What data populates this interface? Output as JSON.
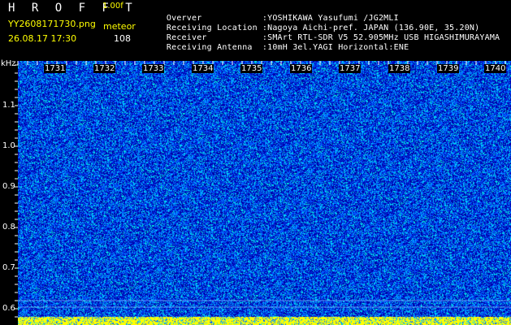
{
  "header": {
    "title": "H R O F F T",
    "version": "1.00f",
    "filename": "YY2608171730.png",
    "mode": "meteor",
    "datetime": "26.08.17 17:30",
    "count": "108"
  },
  "station": [
    {
      "label": "Overver",
      "value": ":YOSHIKAWA Yasufumi /JG2MLI"
    },
    {
      "label": "Receiving Location",
      "value": ":Nagoya Aichi-pref. JAPAN (136.90E, 35.20N)"
    },
    {
      "label": "Receiver",
      "value": ":SMArt RTL-SDR V5 52.905MHz USB HIGASHIMURAYAMA"
    },
    {
      "label": "Receiving Antenna",
      "value": ":10mH 3el.YAGI Horizontal:ENE"
    }
  ],
  "axis": {
    "unit": "kHz",
    "freq_ticks": [
      "1.1",
      "1.0",
      "0.9",
      "0.8",
      "0.7",
      "0.6"
    ],
    "time_labels": [
      "1731",
      "1732",
      "1733",
      "1734",
      "1735",
      "1736",
      "1737",
      "1738",
      "1739",
      "1740"
    ]
  },
  "colors": {
    "background": "#0000aa",
    "noise_low": "#0055ff",
    "noise_mid": "#00ccff",
    "noise_high": "#00ffcc",
    "bottom_band": "#ffff00"
  }
}
